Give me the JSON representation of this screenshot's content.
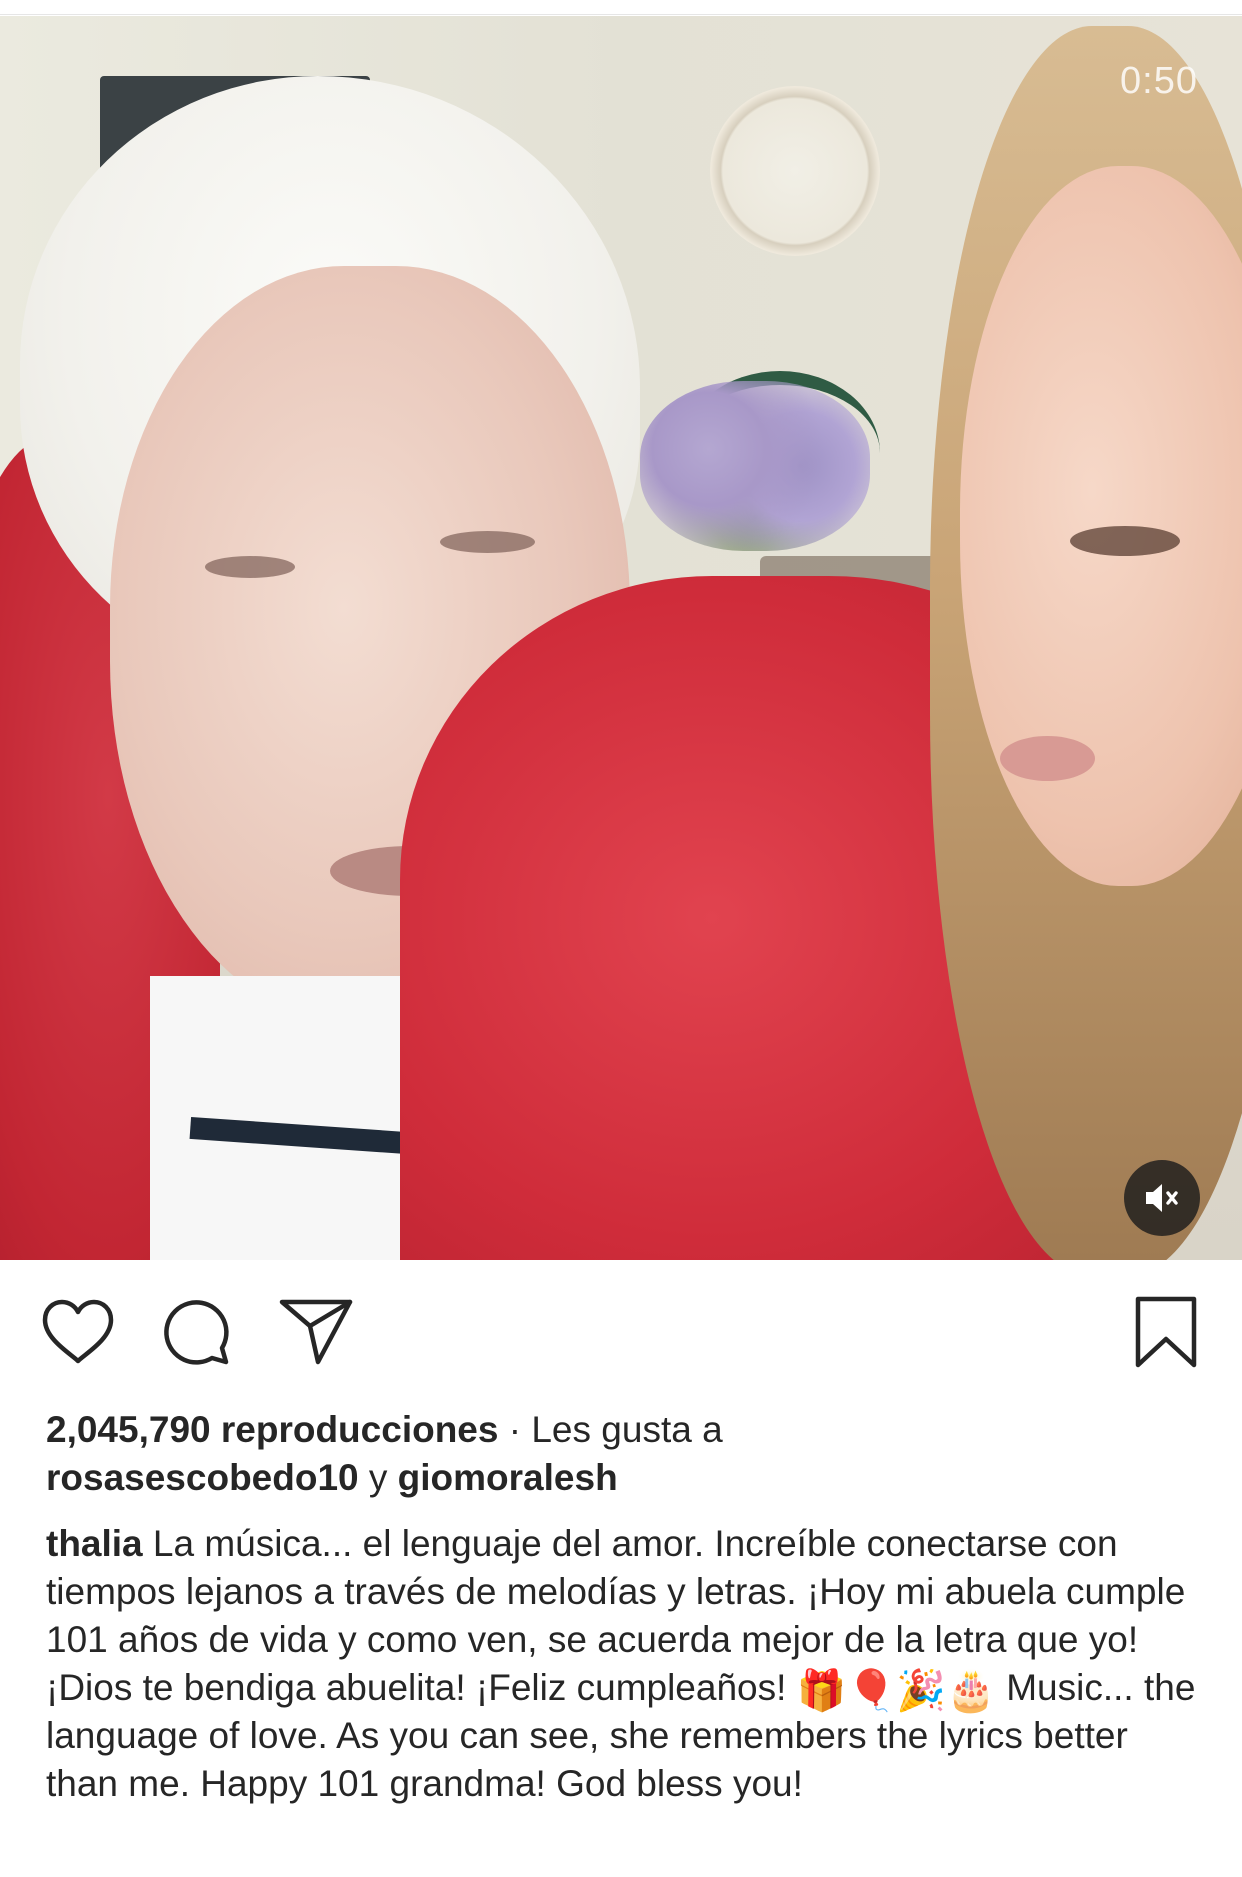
{
  "video": {
    "timer": "0:50",
    "mute_icon": "speaker-muted-icon"
  },
  "actions": {
    "like_icon": "heart-icon",
    "comment_icon": "comment-bubble-icon",
    "share_icon": "paper-plane-icon",
    "save_icon": "bookmark-icon"
  },
  "stats": {
    "views": "2,045,790 reproducciones",
    "liked_by_prefix": " · Les gusta a",
    "liked_user_1": "rosasescobedo10",
    "liked_joiner": " y ",
    "liked_user_2": "giomoralesh"
  },
  "caption": {
    "username": "thalia",
    "text_es": " La música... el lenguaje del amor. Increíble conectarse con tiempos lejanos a través de melodías y letras. ¡Hoy mi abuela cumple 101 años de vida y como ven, se acuerda mejor de la letra que yo! ¡Dios te bendiga abuelita! ¡Feliz cumpleaños! ",
    "emojis": [
      "🎁",
      "🎈",
      "🎉",
      "🎂"
    ],
    "text_en": " Music... the language of love. As you can see, she remembers the lyrics better than me. Happy 101 grandma! God bless you!"
  }
}
